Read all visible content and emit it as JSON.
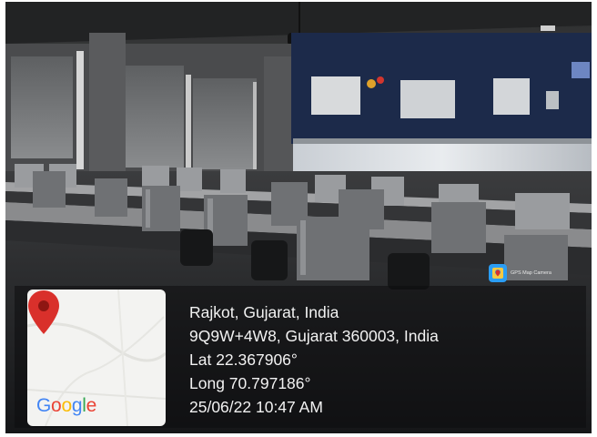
{
  "badge": {
    "text": "GPS Map Camera"
  },
  "google_logo": {
    "letters": [
      "G",
      "o",
      "o",
      "g",
      "l",
      "e"
    ],
    "colors": [
      "#4285F4",
      "#EA4335",
      "#FBBC05",
      "#4285F4",
      "#34A853",
      "#EA4335"
    ]
  },
  "location": {
    "city": "Rajkot, Gujarat, India",
    "address": "9Q9W+4W8, Gujarat 360003, India",
    "lat": "Lat 22.367906°",
    "long": "Long 70.797186°",
    "datetime": "25/06/22 10:47 AM"
  },
  "colors": {
    "pin": "#d9302b",
    "screen_glow": "#dfe4ea",
    "wall_panel": "#1c2a4a"
  }
}
